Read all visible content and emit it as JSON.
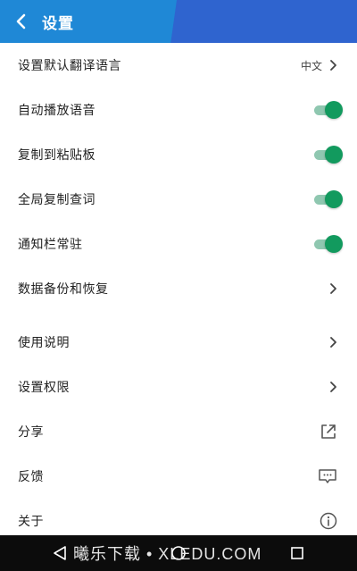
{
  "header": {
    "title": "设置",
    "back_icon": "back-arrow-icon"
  },
  "items": [
    {
      "label": "设置默认翻译语言",
      "value": "中文",
      "control": "chevron"
    },
    {
      "label": "自动播放语音",
      "control": "toggle",
      "checked": true
    },
    {
      "label": "复制到粘贴板",
      "control": "toggle",
      "checked": true
    },
    {
      "label": "全局复制查词",
      "control": "toggle",
      "checked": true
    },
    {
      "label": "通知栏常驻",
      "control": "toggle",
      "checked": true
    },
    {
      "label": "数据备份和恢复",
      "control": "chevron"
    },
    {
      "label": "使用说明",
      "control": "chevron"
    },
    {
      "label": "设置权限",
      "control": "chevron"
    },
    {
      "label": "分享",
      "control": "share-icon"
    },
    {
      "label": "反馈",
      "control": "feedback-icon"
    },
    {
      "label": "关于",
      "control": "info-icon"
    }
  ],
  "watermark": "曦乐下载 • XLEDU.COM",
  "colors": {
    "header": "#1f88d6",
    "toggle_on": "#129a5e",
    "toggle_track": "#8fc7b0",
    "navbar": "#0c0c0c"
  }
}
